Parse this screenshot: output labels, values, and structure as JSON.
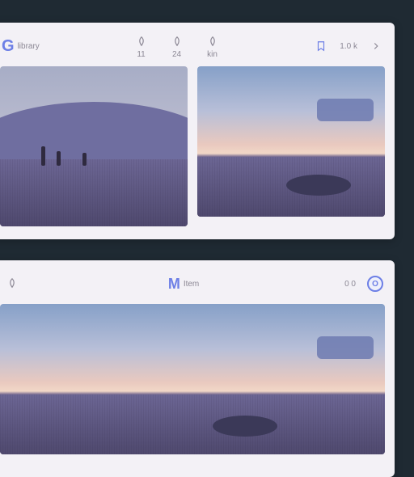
{
  "cards": {
    "a": {
      "brand_label": "G",
      "brand_sub": "library",
      "stats": [
        {
          "icon": "leaf-icon",
          "label": "11"
        },
        {
          "icon": "leaf-icon",
          "label": "24"
        },
        {
          "icon": "leaf-icon",
          "label": "kin"
        }
      ],
      "right": {
        "bookmark": "bookmark-icon",
        "count": "1.0 k",
        "nav": "chevron-icon"
      }
    },
    "b": {
      "brand_label": "M",
      "brand_sub": "Item",
      "stats": [
        {
          "icon": "leaf-icon",
          "label": ""
        }
      ],
      "right": {
        "count": "0 0",
        "avatar": "O"
      }
    }
  }
}
